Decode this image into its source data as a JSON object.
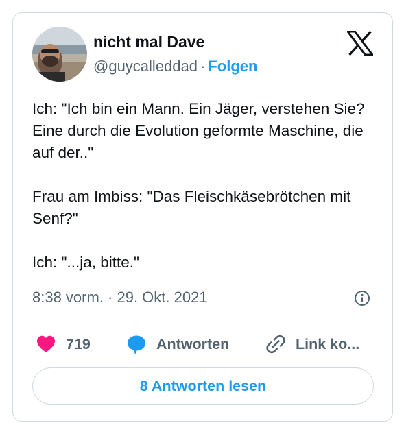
{
  "author": {
    "display_name": "nicht mal Dave",
    "handle": "@guycalleddad",
    "separator": "·",
    "follow_label": "Folgen"
  },
  "tweet": {
    "text": "Ich: \"Ich bin ein Mann. Ein Jäger, verstehen Sie? Eine durch die Evolution geformte Maschine, die auf der..\"\n\nFrau am Imbiss: \"Das Fleischkäsebrötchen mit Senf?\"\n\nIch: \"...ja, bitte.\"",
    "timestamp": "8:38 vorm. · 29. Okt. 2021"
  },
  "actions": {
    "likes_count": "719",
    "reply_label": "Antworten",
    "copy_link_label": "Link ko..."
  },
  "read_replies_label": "8 Antworten lesen",
  "icons": {
    "brand": "x-logo-icon",
    "info": "info-icon",
    "like": "heart-icon",
    "reply": "speech-bubble-icon",
    "link": "link-icon"
  },
  "colors": {
    "accent": "#1d9bf0",
    "like": "#f91880",
    "secondary_text": "#536471",
    "border": "#cfd9de"
  }
}
